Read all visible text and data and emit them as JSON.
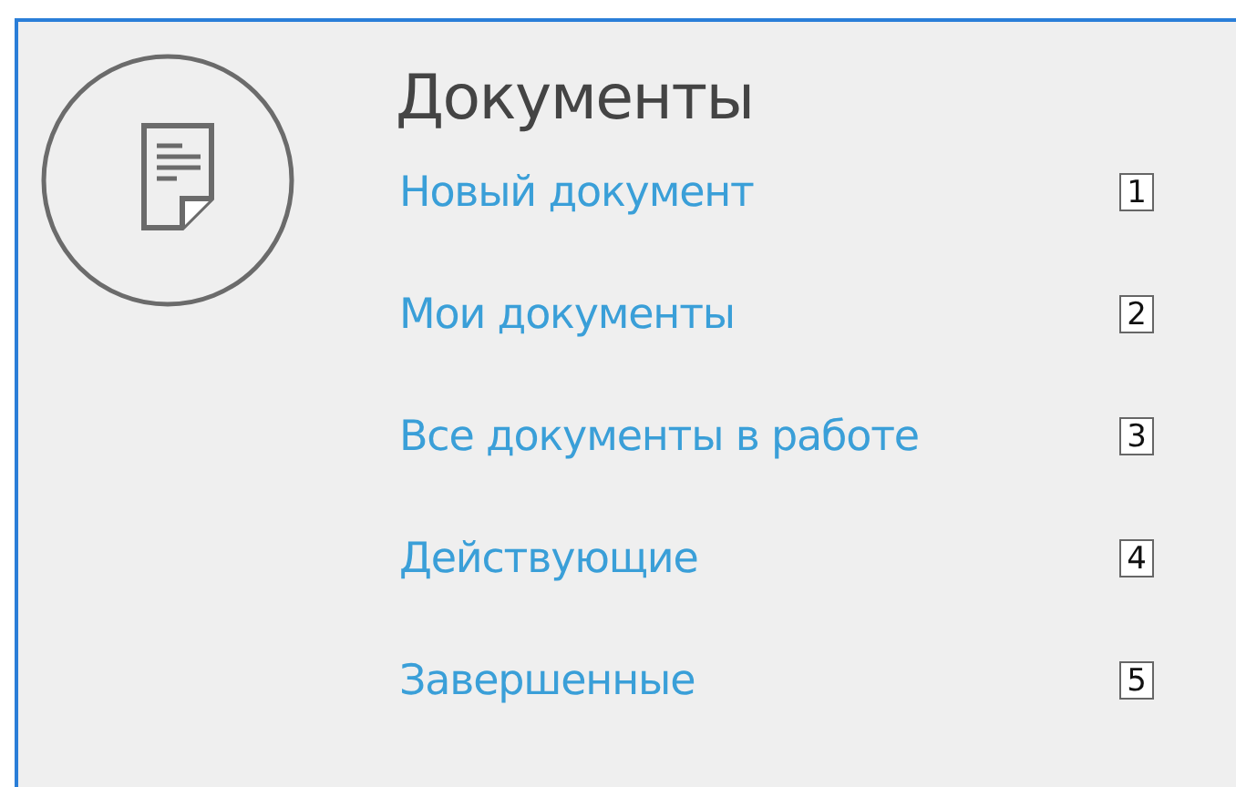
{
  "section": {
    "title": "Документы",
    "items": [
      {
        "label": "Новый документ",
        "key": "1"
      },
      {
        "label": "Мои документы",
        "key": "2"
      },
      {
        "label": "Все документы в работе",
        "key": "3"
      },
      {
        "label": "Действующие",
        "key": "4"
      },
      {
        "label": "Завершенные",
        "key": "5"
      }
    ]
  }
}
